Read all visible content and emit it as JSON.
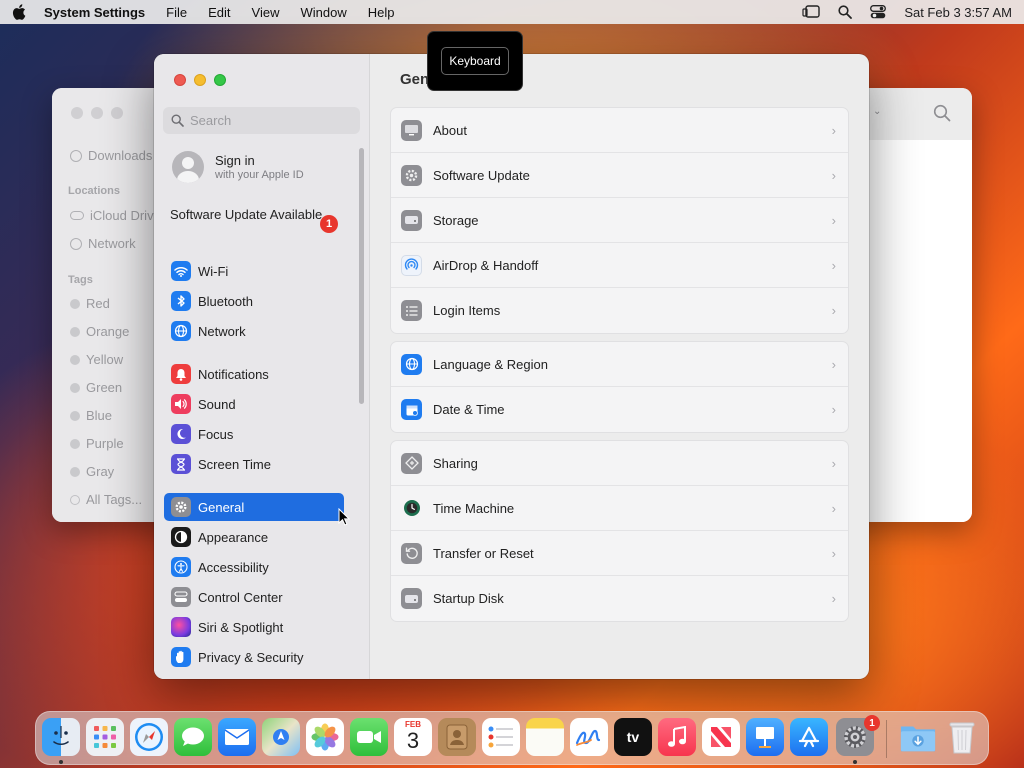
{
  "menubar": {
    "app_name": "System Settings",
    "items": [
      "File",
      "Edit",
      "View",
      "Window",
      "Help"
    ],
    "clock": "Sat Feb 3  3:57 AM"
  },
  "finder": {
    "rows": [
      "Downloads",
      "iCloud Drive",
      "Network"
    ],
    "locations_heading": "Locations",
    "tags_heading": "Tags",
    "tags": [
      "Red",
      "Orange",
      "Yellow",
      "Green",
      "Blue",
      "Purple",
      "Gray",
      "All Tags..."
    ]
  },
  "tooltip": {
    "text": "Keyboard"
  },
  "settings": {
    "search_placeholder": "Search",
    "signin": {
      "title": "Sign in",
      "subtitle": "with your Apple ID"
    },
    "update": {
      "label": "Software Update Available",
      "badge": "1"
    },
    "nav": [
      {
        "label": "Wi-Fi",
        "color": "#1f7cf0",
        "icon": "wifi-icon"
      },
      {
        "label": "Bluetooth",
        "color": "#1f7cf0",
        "icon": "bluetooth-icon"
      },
      {
        "label": "Network",
        "color": "#1f7cf0",
        "icon": "globe-icon"
      },
      {
        "label": "Notifications",
        "color": "#ee3d3d",
        "icon": "bell-icon"
      },
      {
        "label": "Sound",
        "color": "#ee3d5e",
        "icon": "speaker-icon"
      },
      {
        "label": "Focus",
        "color": "#5b50d6",
        "icon": "moon-icon"
      },
      {
        "label": "Screen Time",
        "color": "#5b50d6",
        "icon": "hourglass-icon"
      },
      {
        "label": "General",
        "color": "#8e8e93",
        "icon": "gear-icon"
      },
      {
        "label": "Appearance",
        "color": "#1a1a1a",
        "icon": "appearance-icon"
      },
      {
        "label": "Accessibility",
        "color": "#1f7cf0",
        "icon": "accessibility-icon"
      },
      {
        "label": "Control Center",
        "color": "#8e8e93",
        "icon": "control-center-icon"
      },
      {
        "label": "Siri & Spotlight",
        "color": "#b03ad8",
        "icon": "siri-icon"
      },
      {
        "label": "Privacy & Security",
        "color": "#1f7cf0",
        "icon": "hand-icon"
      }
    ],
    "pane_title": "General",
    "groups": [
      [
        {
          "label": "About",
          "icon": "display-icon"
        },
        {
          "label": "Software Update",
          "icon": "gear-badge-icon"
        },
        {
          "label": "Storage",
          "icon": "drive-icon"
        },
        {
          "label": "AirDrop & Handoff",
          "icon": "airdrop-icon"
        },
        {
          "label": "Login Items",
          "icon": "list-icon"
        }
      ],
      [
        {
          "label": "Language & Region",
          "icon": "globe-icon"
        },
        {
          "label": "Date & Time",
          "icon": "calendar-icon"
        }
      ],
      [
        {
          "label": "Sharing",
          "icon": "sharing-icon"
        },
        {
          "label": "Time Machine",
          "icon": "time-machine-icon"
        },
        {
          "label": "Transfer or Reset",
          "icon": "reset-icon"
        },
        {
          "label": "Startup Disk",
          "icon": "disk-icon"
        }
      ]
    ]
  },
  "dock": {
    "apps": [
      "Finder",
      "Launchpad",
      "Safari",
      "Messages",
      "Mail",
      "Maps",
      "Photos",
      "FaceTime",
      "Calendar",
      "Contacts",
      "Reminders",
      "Notes",
      "Freeform",
      "TV",
      "Music",
      "News",
      "Keynote",
      "App Store",
      "System Settings",
      "Downloads",
      "Trash"
    ],
    "calendar_month": "FEB",
    "calendar_day": "3",
    "tv_label": "tv",
    "settings_badge": "1"
  }
}
